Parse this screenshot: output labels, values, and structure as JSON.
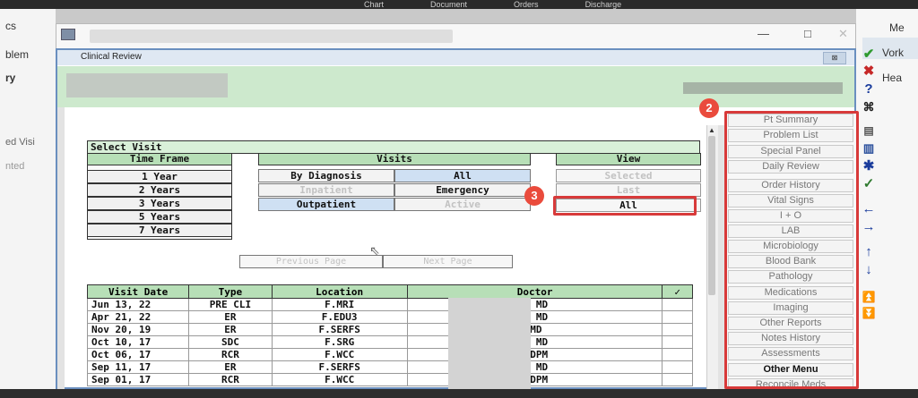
{
  "top_tabs": [
    "Chart",
    "Document",
    "Orders",
    "Discharge"
  ],
  "left_partial": [
    "cs",
    "blem",
    "ry",
    "ed Visi",
    "nted"
  ],
  "right_partial": [
    "Me",
    "Vork",
    "Hea"
  ],
  "outer_window": {
    "minimize": "—",
    "maximize": "□",
    "close": "✕"
  },
  "inner_window": {
    "title": "Clinical Review",
    "close": "⊠"
  },
  "select_visit": {
    "title": "Select Visit",
    "time_frame": {
      "header": "Time Frame",
      "options": [
        "1 Year",
        "2 Years",
        "3 Years",
        "5 Years",
        "7 Years"
      ]
    },
    "visits": {
      "header": "Visits",
      "rows": [
        [
          "By Diagnosis",
          "All"
        ],
        [
          "Inpatient",
          "Emergency"
        ],
        [
          "Outpatient",
          "Active"
        ]
      ]
    },
    "view": {
      "header": "View",
      "options": [
        "Selected",
        "Last",
        "All"
      ]
    },
    "buttons": {
      "previous": "Previous Page",
      "next": "Next Page"
    }
  },
  "visits_table": {
    "columns": [
      "Visit Date",
      "Type",
      "Location",
      "Doctor",
      "✓"
    ],
    "rows": [
      [
        "Jun 13, 22",
        "PRE CLI",
        "F.MRI",
        "th M  MD"
      ],
      [
        "Apr 21, 22",
        "ER",
        "F.EDU3",
        "rc M MD"
      ],
      [
        "Nov 20, 19",
        "ER",
        "F.SERFS",
        "n R  MD"
      ],
      [
        "Oct 10, 17",
        "SDC",
        "F.SRG",
        "en D  MD"
      ],
      [
        "Oct 06, 17",
        "RCR",
        "F.WCC",
        "t B  DPM"
      ],
      [
        "Sep 11, 17",
        "ER",
        "F.SERFS",
        "am M  MD"
      ],
      [
        "Sep 01, 17",
        "RCR",
        "F.WCC",
        "t B  DPM"
      ]
    ]
  },
  "menu": [
    "Pt Summary",
    "Problem List",
    "Special Panel",
    "Daily Review",
    "Order History",
    "Vital Signs",
    "I + O",
    "LAB",
    "Microbiology",
    "Blood Bank",
    "Pathology",
    "Medications",
    "Imaging",
    "Other Reports",
    "Notes History",
    "Assessments",
    "Other Menu",
    "Reconcile Meds"
  ],
  "badges": {
    "menu": "2",
    "view_all": "3"
  },
  "toolbar_icons": [
    "check-icon",
    "x-icon",
    "help-icon",
    "binoculars-icon",
    "dates-icon",
    "chart-icon",
    "star-icon",
    "check-list-icon",
    "arrow-left-icon",
    "arrow-right-icon",
    "arrow-up-icon",
    "arrow-down-icon",
    "double-up-icon",
    "double-down-icon"
  ],
  "colors": {
    "accent_green": "#cde9cd",
    "header_green": "#b7dfb7",
    "annotation_red": "#d83a3a",
    "title_blue": "#dfe8f3"
  }
}
